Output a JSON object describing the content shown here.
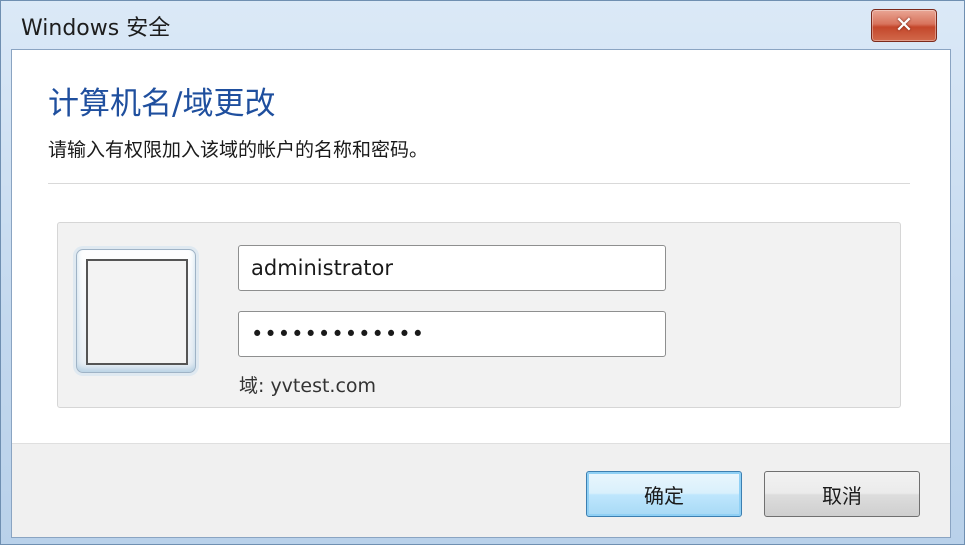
{
  "window": {
    "title": "Windows 安全",
    "close_label": "✕"
  },
  "dialog": {
    "heading": "计算机名/域更改",
    "description": "请输入有权限加入该域的帐户的名称和密码。"
  },
  "credentials": {
    "username_value": "administrator",
    "password_value": "•••••••••••••",
    "domain_text": "域: yvtest.com"
  },
  "buttons": {
    "ok_label": "确定",
    "cancel_label": "取消"
  }
}
